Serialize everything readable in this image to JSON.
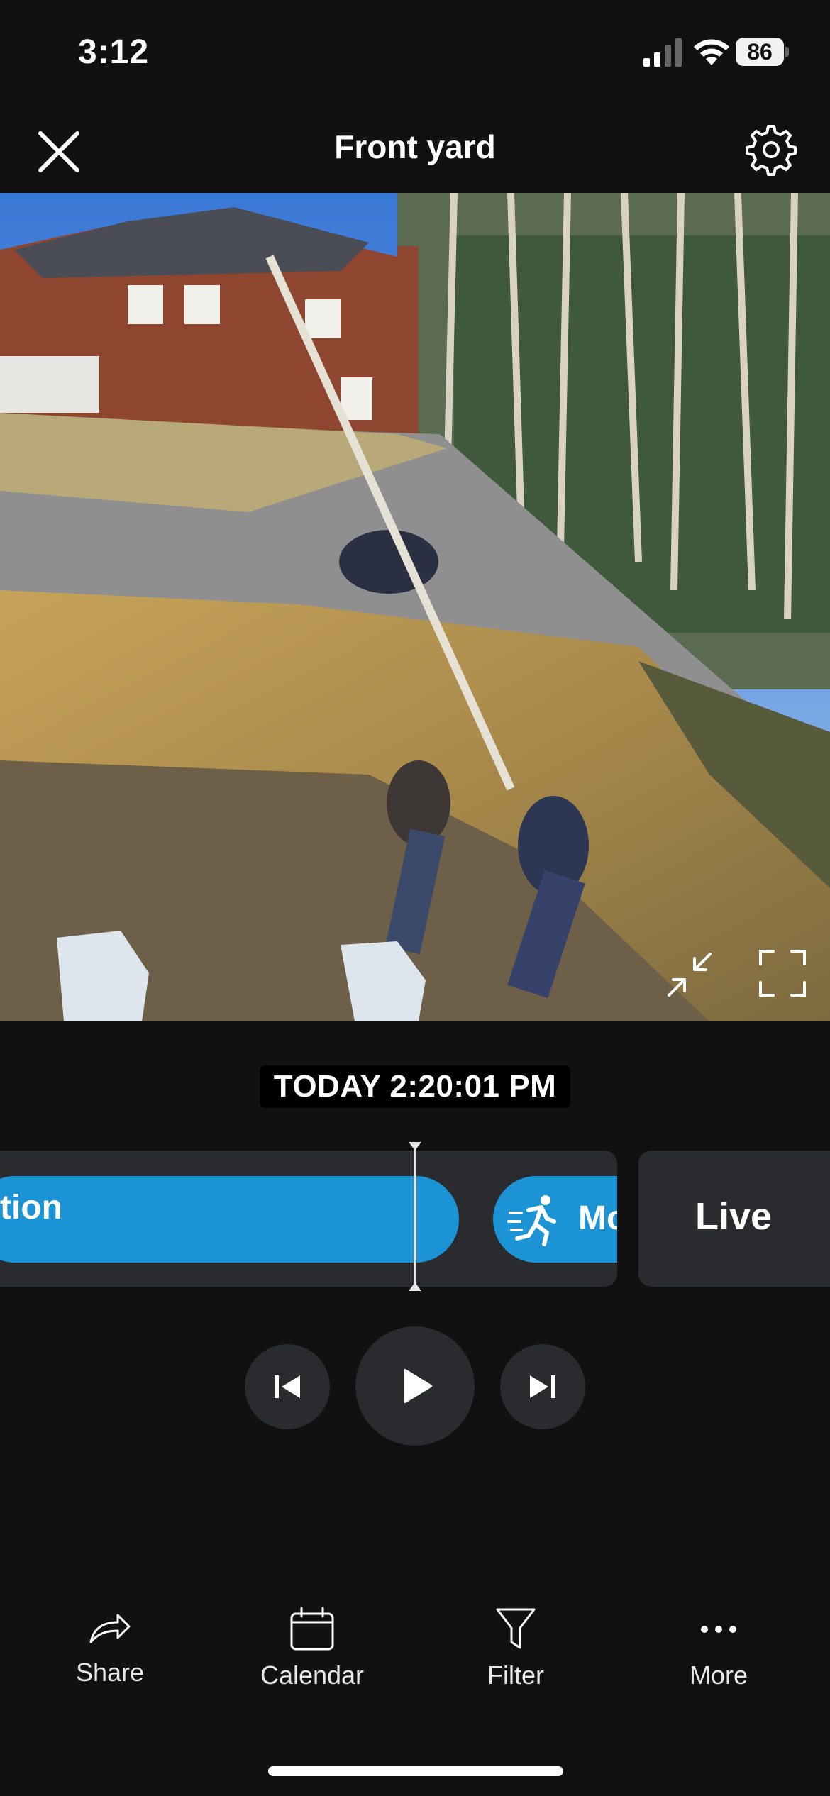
{
  "status_bar": {
    "time": "3:12",
    "battery": "86"
  },
  "nav": {
    "title": "Front yard",
    "close_icon": "close-icon",
    "settings_icon": "gear-icon"
  },
  "video": {
    "pip_icon": "minimize-arrows-icon",
    "fullscreen_icon": "fullscreen-icon"
  },
  "timestamp": "TODAY 2:20:01 PM",
  "timeline": {
    "current_event_label": "tion",
    "next_event_label": "Mo",
    "next_event_icon": "running-person-icon",
    "live_label": "Live"
  },
  "controls": {
    "prev_icon": "skip-previous-icon",
    "play_icon": "play-icon",
    "next_icon": "skip-next-icon"
  },
  "toolbar": {
    "items": [
      {
        "label": "Share",
        "icon": "share-arrow-icon"
      },
      {
        "label": "Calendar",
        "icon": "calendar-icon"
      },
      {
        "label": "Filter",
        "icon": "filter-funnel-icon"
      },
      {
        "label": "More",
        "icon": "more-dots-icon"
      }
    ]
  },
  "colors": {
    "accent": "#1b93d4",
    "background": "#111112",
    "panel": "#2a2b2f"
  }
}
